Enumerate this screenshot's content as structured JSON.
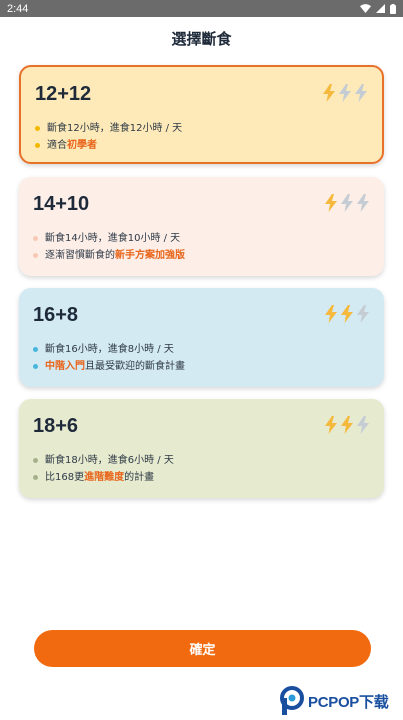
{
  "status_bar": {
    "time": "2:44"
  },
  "page": {
    "title": "選擇斷食",
    "confirm_label": "確定"
  },
  "colors": {
    "accent": "#f26a0f",
    "highlight_text": "#e8651c",
    "bolt_active": "#f5b93d",
    "bolt_inactive": "#c5ccd4"
  },
  "plans": [
    {
      "name": "12+12",
      "selected": true,
      "intensity": 1,
      "bg": "#fdeab8",
      "dot": "#f5b800",
      "line1": "斷食12小時，進食12小時 / 天",
      "line2_prefix": "適合 ",
      "line2_highlight": "初學者",
      "line2_suffix": ""
    },
    {
      "name": "14+10",
      "selected": false,
      "intensity": 1,
      "bg": "#fdefe8",
      "dot": "#f7c9b4",
      "line1": "斷食14小時，進食10小時 / 天",
      "line2_prefix": "逐漸習慣斷食的",
      "line2_highlight": "新手方案加強版",
      "line2_suffix": ""
    },
    {
      "name": "16+8",
      "selected": false,
      "intensity": 2,
      "bg": "#d4eaf2",
      "dot": "#46b6dc",
      "line1": "斷食16小時，進食8小時 / 天",
      "line2_prefix": "",
      "line2_highlight": "中階入門",
      "line2_suffix": "且最受歡迎的斷食計畫"
    },
    {
      "name": "18+6",
      "selected": false,
      "intensity": 2,
      "bg": "#e6ebcf",
      "dot": "#a6b08c",
      "line1": "斷食18小時，進食6小時 / 天",
      "line2_prefix": "比168更",
      "line2_highlight": "進階難度",
      "line2_suffix": "的計畫"
    }
  ],
  "watermark": {
    "text": "PCPOP下载"
  }
}
